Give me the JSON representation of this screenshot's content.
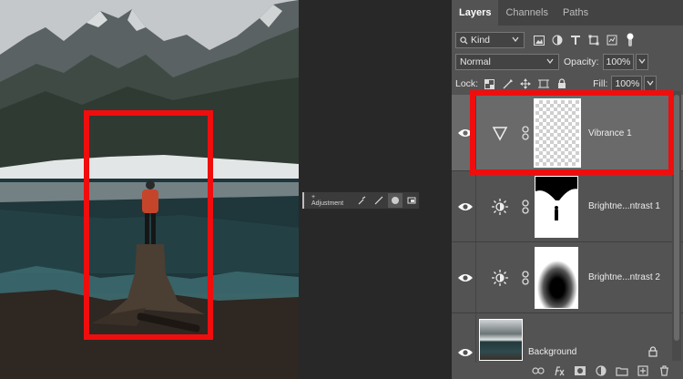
{
  "panel": {
    "tabs": [
      {
        "label": "Layers",
        "active": true
      },
      {
        "label": "Channels",
        "active": false
      },
      {
        "label": "Paths",
        "active": false
      }
    ],
    "filter_kind": "Kind",
    "blend_mode": "Normal",
    "opacity_label": "Opacity:",
    "opacity_value": "100%",
    "lock_label": "Lock:",
    "fill_label": "Fill:",
    "fill_value": "100%",
    "layers": [
      {
        "name": "Vibrance 1",
        "type": "vibrance",
        "visible": true,
        "selected": true
      },
      {
        "name": "Brightne...ntrast 1",
        "type": "brightness-contrast",
        "visible": true,
        "selected": false
      },
      {
        "name": "Brightne...ntrast 2",
        "type": "brightness-contrast",
        "visible": true,
        "selected": false
      },
      {
        "name": "Background",
        "type": "pixel",
        "visible": true,
        "locked": true,
        "selected": false
      }
    ]
  },
  "properties_bar": {
    "adjustment_label": "+ Adjustment"
  },
  "colors": {
    "highlight": "#f00d0d",
    "panel_bg": "#535353",
    "tab_bar_bg": "#434343",
    "workspace_bg": "#282828"
  }
}
